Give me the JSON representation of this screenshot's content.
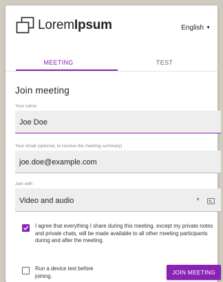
{
  "brand": {
    "name_light": "Lorem",
    "name_bold": "Ipsum"
  },
  "language": {
    "selected": "English"
  },
  "tabs": [
    {
      "label": "MEETING",
      "active": true
    },
    {
      "label": "TEST",
      "active": false
    }
  ],
  "form": {
    "title": "Join meeting",
    "name": {
      "label": "Your name",
      "value": "Joe Doe"
    },
    "email": {
      "label": "Your email (optional, to receive the meeting summary)",
      "value": "joe.doe@example.com"
    },
    "join_with": {
      "label": "Join with",
      "value": "Video and audio"
    }
  },
  "consent": {
    "checked": true,
    "text": "I agree that everything I share during this meeting, except my private notes and private chats, will be made available to all other meeting participants during and after the meeting."
  },
  "device_test": {
    "checked": false,
    "text": "Run a device test before joining."
  },
  "actions": {
    "join_label": "JOIN MEETING"
  },
  "colors": {
    "accent": "#8a22b5",
    "field_bg": "#eeeeee",
    "background": "#cfcbbf"
  },
  "icons": {
    "logo": "overlapping-squares-logo",
    "language_caret": "caret-down-icon",
    "join_with_caret": "caret-down-icon",
    "join_with_device": "camera-settings-icon",
    "consent_check": "checkmark-icon"
  }
}
